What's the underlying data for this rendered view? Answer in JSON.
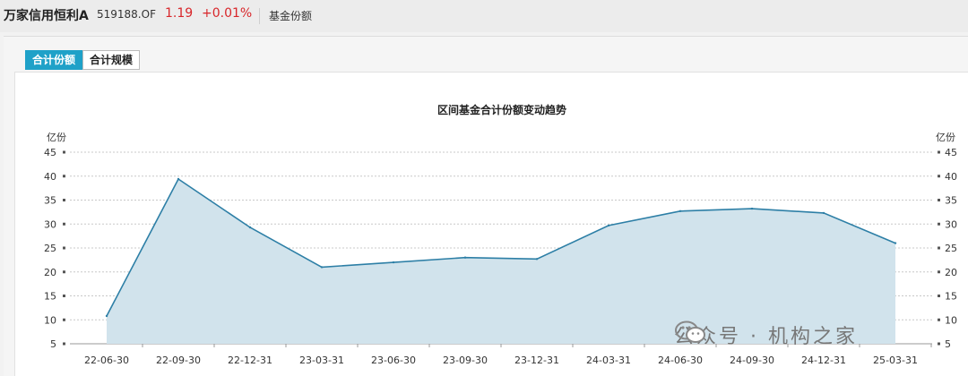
{
  "header": {
    "fund_name": "万家信用恒利A",
    "fund_code": "519188.OF",
    "price": "1.19",
    "change": "+0.01%",
    "section": "基金份额"
  },
  "tabs": [
    {
      "label": "合计份额",
      "active": true
    },
    {
      "label": "合计规模",
      "active": false
    }
  ],
  "watermark": {
    "text": "公众号 · 机构之家",
    "icon": "wechat-icon"
  },
  "colors": {
    "line": "#2d7fa6",
    "area": "#d1e3ec",
    "accent": "#1fa1c8",
    "up": "#d8262a"
  },
  "chart_data": {
    "type": "area",
    "title": "区间基金合计份额变动趋势",
    "ylabel": "亿份",
    "ylabel_right": "亿份",
    "x": [
      "22-06-30",
      "22-09-30",
      "22-12-31",
      "23-03-31",
      "23-06-30",
      "23-09-30",
      "23-12-31",
      "24-03-31",
      "24-06-30",
      "24-09-30",
      "24-12-31",
      "25-03-31"
    ],
    "values": [
      10.8,
      39.4,
      29.3,
      21.0,
      22.0,
      23.0,
      22.7,
      29.7,
      32.7,
      33.2,
      32.3,
      26.0
    ],
    "ylim": [
      5,
      45
    ],
    "yticks": [
      5,
      10,
      15,
      20,
      25,
      30,
      35,
      40,
      45
    ],
    "grid": true
  }
}
